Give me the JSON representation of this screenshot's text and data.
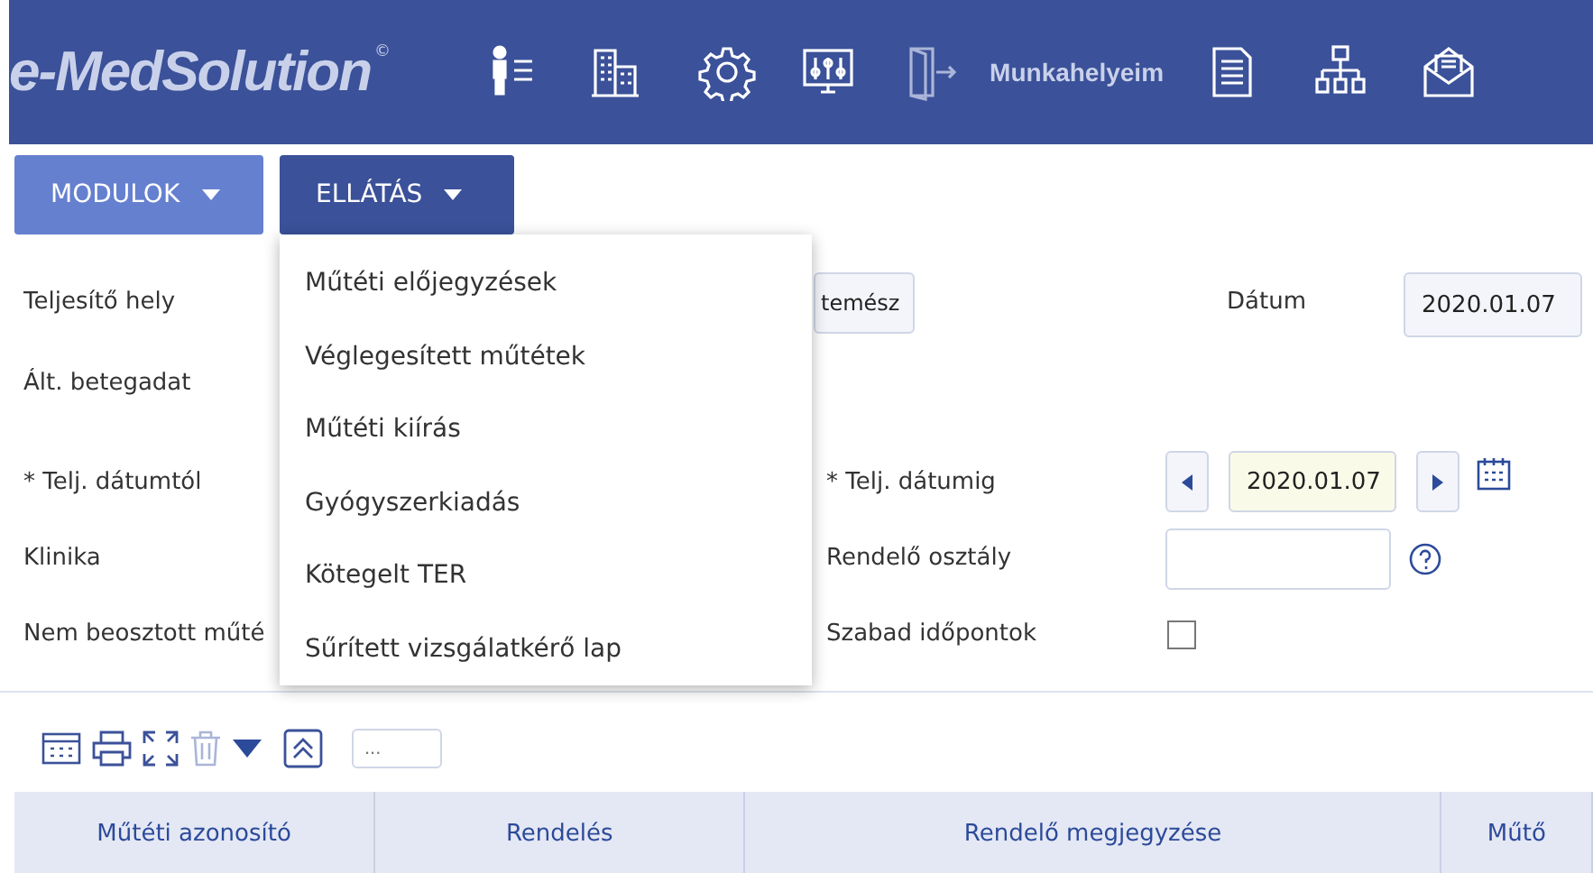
{
  "header": {
    "logo": "e-MedSolution",
    "logo_mark": "©",
    "workplaces_link": "Munkahelyeim"
  },
  "nav_buttons": [
    {
      "label": "MODULOK",
      "selected": false
    },
    {
      "label": "ELLÁTÁS",
      "selected": true
    }
  ],
  "dropdown_menu": {
    "items": [
      "Műtéti előjegyzések",
      "Véglegesített műtétek",
      "Műtéti kiírás",
      "Gyógyszerkiadás",
      "Kötegelt TER",
      "Sűrített vizsgálatkérő lap"
    ]
  },
  "form": {
    "performer_label": "Teljesítő hely",
    "performer_value": "temész",
    "date_label": "Dátum",
    "date_value": "2020.01.07",
    "patient_label": "Ált. betegadat",
    "from_label": "* Telj. dátumtól",
    "to_label": "* Telj. dátumig",
    "to_value": "2020.01.07",
    "clinic_label": "Klinika",
    "department_label": "Rendelő osztály",
    "unassigned_label": "Nem beosztott műté",
    "free_slots_label": "Szabad időpontok",
    "free_slots_checked": false
  },
  "toolbar": {
    "filter_placeholder": "..."
  },
  "table": {
    "columns": [
      "Műtéti azonosító",
      "Rendelés",
      "Rendelő megjegyzése",
      "Műtő"
    ]
  }
}
